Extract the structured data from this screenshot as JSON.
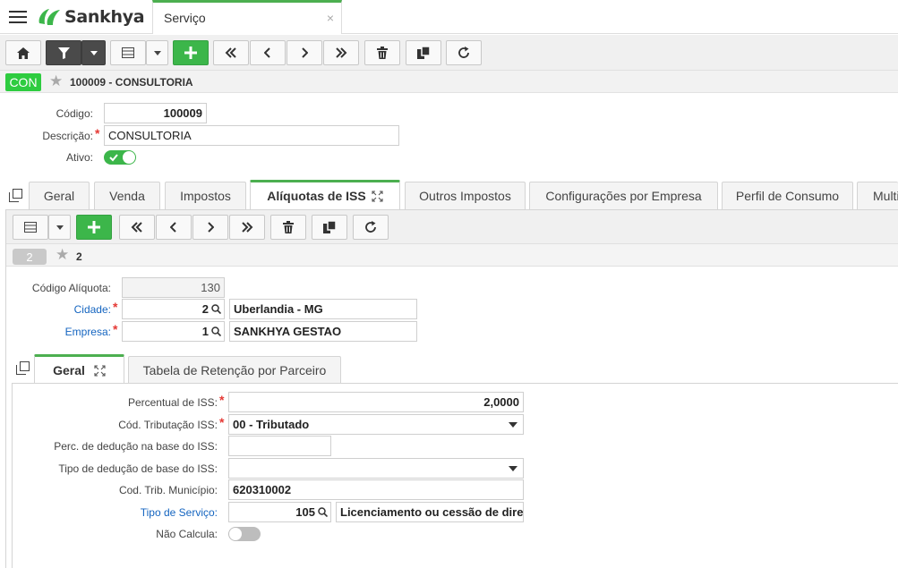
{
  "header": {
    "logo_text": "Sankhya",
    "tab_title": "Serviço",
    "tab_close": "×"
  },
  "record": {
    "badge": "CON",
    "title": "100009 - CONSULTORIA"
  },
  "form": {
    "codigo_label": "Código:",
    "codigo_value": "100009",
    "descricao_label": "Descrição:",
    "descricao_value": "CONSULTORIA",
    "ativo_label": "Ativo:",
    "required_mark": "*"
  },
  "tabs": [
    {
      "label": "Geral"
    },
    {
      "label": "Venda"
    },
    {
      "label": "Impostos"
    },
    {
      "label": "Alíquotas de ISS"
    },
    {
      "label": "Outros Impostos"
    },
    {
      "label": "Configurações por Empresa"
    },
    {
      "label": "Perfil de Consumo"
    },
    {
      "label": "Multi"
    }
  ],
  "sub_record": {
    "badge": "2",
    "title": "2"
  },
  "aliquota": {
    "codigo_label": "Código Alíquota:",
    "codigo_value": "130",
    "cidade_label": "Cidade:",
    "cidade_code": "2",
    "cidade_name": "Uberlandia - MG",
    "empresa_label": "Empresa:",
    "empresa_code": "1",
    "empresa_name": "SANKHYA GESTAO"
  },
  "subtabs": [
    {
      "label": "Geral"
    },
    {
      "label": "Tabela de Retenção por Parceiro"
    }
  ],
  "geral": {
    "percentual_label": "Percentual de ISS:",
    "percentual_value": "2,0000",
    "tributacao_label": "Cód. Tributação ISS:",
    "tributacao_value": "00 - Tributado",
    "perc_deducao_label": "Perc. de dedução na base do ISS:",
    "perc_deducao_value": "",
    "tipo_deducao_label": "Tipo de dedução de base do ISS:",
    "tipo_deducao_value": "",
    "cod_trib_label": "Cod. Trib. Município:",
    "cod_trib_value": "620310002",
    "tipo_servico_label": "Tipo de Serviço:",
    "tipo_servico_code": "105",
    "tipo_servico_name": "Licenciamento ou cessão de direito",
    "nao_calcula_label": "Não Calcula:"
  },
  "colors": {
    "accent_green": "#3cb64a",
    "link_blue": "#1565c0",
    "required_red": "#e53935"
  },
  "icons": [
    "menu-icon",
    "home-icon",
    "filter-icon",
    "grid-icon",
    "plus-icon",
    "first-icon",
    "prev-icon",
    "next-icon",
    "last-icon",
    "trash-icon",
    "copy-icon",
    "refresh-icon",
    "star-icon",
    "search-icon",
    "expand-icon",
    "clone-icon"
  ]
}
